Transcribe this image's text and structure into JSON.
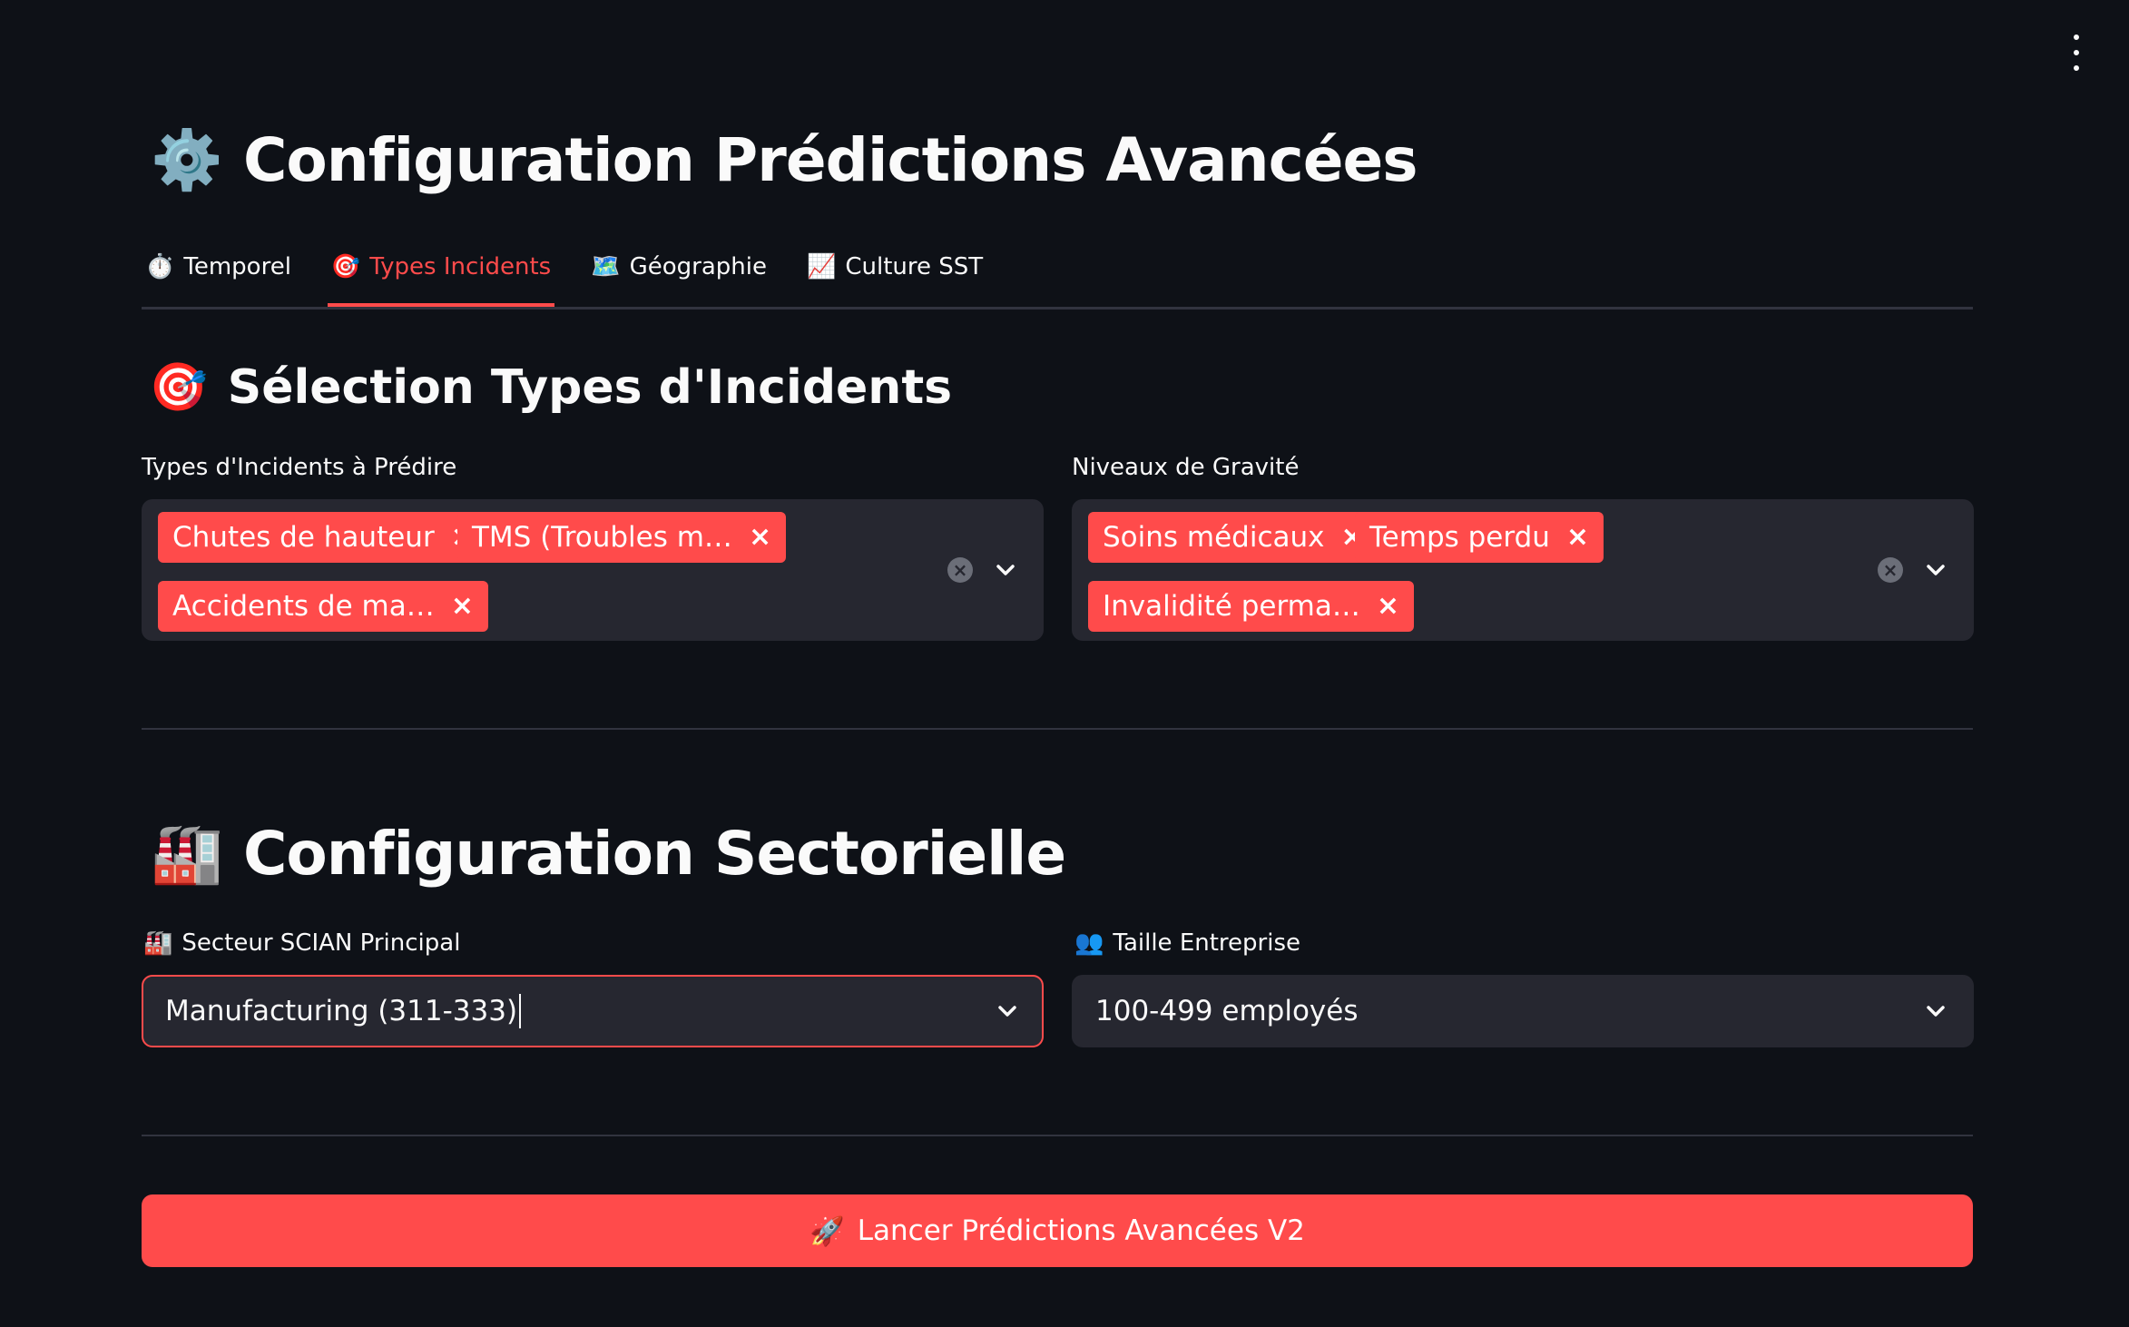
{
  "app": {
    "title_icon": "gear-icon",
    "title": "Configuration Prédictions Avancées",
    "menu_icon": "kebab-menu-icon"
  },
  "tabs": [
    {
      "icon": "stopwatch-icon",
      "label": "Temporel",
      "active": false
    },
    {
      "icon": "target-icon",
      "label": "Types Incidents",
      "active": true
    },
    {
      "icon": "map-icon",
      "label": "Géographie",
      "active": false
    },
    {
      "icon": "chart-increasing-icon",
      "label": "Culture SST",
      "active": false
    }
  ],
  "incidents_section": {
    "icon": "target-icon",
    "title": "Sélection Types d'Incidents",
    "types_field": {
      "label": "Types d'Incidents à Prédire",
      "selected": [
        "Chutes de hauteur",
        "TMS (Troubles m…",
        "Accidents de ma…"
      ]
    },
    "severity_field": {
      "label": "Niveaux de Gravité",
      "selected": [
        "Soins médicaux",
        "Temps perdu",
        "Invalidité perma…"
      ]
    }
  },
  "sector_section": {
    "icon": "factory-icon",
    "title": "Configuration Sectorielle",
    "scian_field": {
      "icon": "factory-icon",
      "label": "Secteur SCIAN Principal",
      "value": "Manufacturing (311-333)"
    },
    "size_field": {
      "icon": "people-icon",
      "label": "Taille Entreprise",
      "value": "100-499 employés"
    }
  },
  "launch_button": {
    "icon": "rocket-icon",
    "label": "Lancer Prédictions Avancées V2"
  },
  "colors": {
    "background": "#0e1117",
    "surface": "#262730",
    "accent": "#ff4b4b",
    "text": "#fafafa"
  }
}
